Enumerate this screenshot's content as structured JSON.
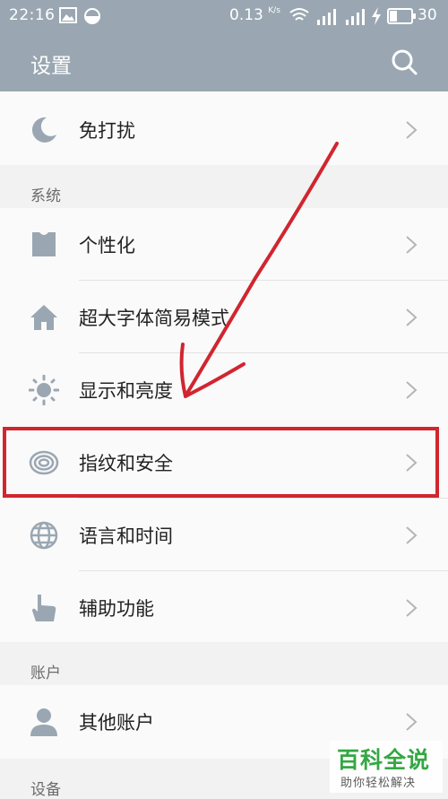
{
  "status_bar": {
    "time": "22:16",
    "network_speed": "0.13",
    "network_unit": "K/s",
    "battery": "30"
  },
  "header": {
    "title": "设置"
  },
  "rows": {
    "dnd": "免打扰",
    "personalize": "个性化",
    "simple_mode": "超大字体简易模式",
    "display": "显示和亮度",
    "fingerprint": "指纹和安全",
    "language": "语言和时间",
    "accessibility": "辅助功能",
    "other_accounts": "其他账户"
  },
  "sections": {
    "system": "系统",
    "accounts": "账户",
    "devices": "设备"
  },
  "icons": {
    "dnd": "moon-icon",
    "personalize": "shirt-icon",
    "simple_mode": "home-icon",
    "display": "sun-icon",
    "fingerprint": "fingerprint-icon",
    "language": "globe-icon",
    "accessibility": "hand-pointer-icon",
    "other_accounts": "person-icon"
  },
  "colors": {
    "header_bg": "#9aa7b2",
    "icon": "#9aa7b2",
    "highlight": "#d0262f",
    "watermark": "#2aa339"
  },
  "watermark": {
    "main": "百科全说",
    "sub": "助你轻松解决"
  }
}
